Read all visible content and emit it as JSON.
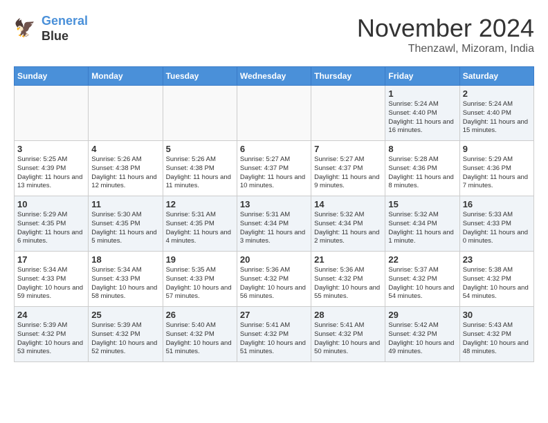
{
  "header": {
    "logo_line1": "General",
    "logo_line2": "Blue",
    "month": "November 2024",
    "location": "Thenzawl, Mizoram, India"
  },
  "weekdays": [
    "Sunday",
    "Monday",
    "Tuesday",
    "Wednesday",
    "Thursday",
    "Friday",
    "Saturday"
  ],
  "weeks": [
    [
      {
        "day": "",
        "text": ""
      },
      {
        "day": "",
        "text": ""
      },
      {
        "day": "",
        "text": ""
      },
      {
        "day": "",
        "text": ""
      },
      {
        "day": "",
        "text": ""
      },
      {
        "day": "1",
        "text": "Sunrise: 5:24 AM\nSunset: 4:40 PM\nDaylight: 11 hours and 16 minutes."
      },
      {
        "day": "2",
        "text": "Sunrise: 5:24 AM\nSunset: 4:40 PM\nDaylight: 11 hours and 15 minutes."
      }
    ],
    [
      {
        "day": "3",
        "text": "Sunrise: 5:25 AM\nSunset: 4:39 PM\nDaylight: 11 hours and 13 minutes."
      },
      {
        "day": "4",
        "text": "Sunrise: 5:26 AM\nSunset: 4:38 PM\nDaylight: 11 hours and 12 minutes."
      },
      {
        "day": "5",
        "text": "Sunrise: 5:26 AM\nSunset: 4:38 PM\nDaylight: 11 hours and 11 minutes."
      },
      {
        "day": "6",
        "text": "Sunrise: 5:27 AM\nSunset: 4:37 PM\nDaylight: 11 hours and 10 minutes."
      },
      {
        "day": "7",
        "text": "Sunrise: 5:27 AM\nSunset: 4:37 PM\nDaylight: 11 hours and 9 minutes."
      },
      {
        "day": "8",
        "text": "Sunrise: 5:28 AM\nSunset: 4:36 PM\nDaylight: 11 hours and 8 minutes."
      },
      {
        "day": "9",
        "text": "Sunrise: 5:29 AM\nSunset: 4:36 PM\nDaylight: 11 hours and 7 minutes."
      }
    ],
    [
      {
        "day": "10",
        "text": "Sunrise: 5:29 AM\nSunset: 4:35 PM\nDaylight: 11 hours and 6 minutes."
      },
      {
        "day": "11",
        "text": "Sunrise: 5:30 AM\nSunset: 4:35 PM\nDaylight: 11 hours and 5 minutes."
      },
      {
        "day": "12",
        "text": "Sunrise: 5:31 AM\nSunset: 4:35 PM\nDaylight: 11 hours and 4 minutes."
      },
      {
        "day": "13",
        "text": "Sunrise: 5:31 AM\nSunset: 4:34 PM\nDaylight: 11 hours and 3 minutes."
      },
      {
        "day": "14",
        "text": "Sunrise: 5:32 AM\nSunset: 4:34 PM\nDaylight: 11 hours and 2 minutes."
      },
      {
        "day": "15",
        "text": "Sunrise: 5:32 AM\nSunset: 4:34 PM\nDaylight: 11 hours and 1 minute."
      },
      {
        "day": "16",
        "text": "Sunrise: 5:33 AM\nSunset: 4:33 PM\nDaylight: 11 hours and 0 minutes."
      }
    ],
    [
      {
        "day": "17",
        "text": "Sunrise: 5:34 AM\nSunset: 4:33 PM\nDaylight: 10 hours and 59 minutes."
      },
      {
        "day": "18",
        "text": "Sunrise: 5:34 AM\nSunset: 4:33 PM\nDaylight: 10 hours and 58 minutes."
      },
      {
        "day": "19",
        "text": "Sunrise: 5:35 AM\nSunset: 4:33 PM\nDaylight: 10 hours and 57 minutes."
      },
      {
        "day": "20",
        "text": "Sunrise: 5:36 AM\nSunset: 4:32 PM\nDaylight: 10 hours and 56 minutes."
      },
      {
        "day": "21",
        "text": "Sunrise: 5:36 AM\nSunset: 4:32 PM\nDaylight: 10 hours and 55 minutes."
      },
      {
        "day": "22",
        "text": "Sunrise: 5:37 AM\nSunset: 4:32 PM\nDaylight: 10 hours and 54 minutes."
      },
      {
        "day": "23",
        "text": "Sunrise: 5:38 AM\nSunset: 4:32 PM\nDaylight: 10 hours and 54 minutes."
      }
    ],
    [
      {
        "day": "24",
        "text": "Sunrise: 5:39 AM\nSunset: 4:32 PM\nDaylight: 10 hours and 53 minutes."
      },
      {
        "day": "25",
        "text": "Sunrise: 5:39 AM\nSunset: 4:32 PM\nDaylight: 10 hours and 52 minutes."
      },
      {
        "day": "26",
        "text": "Sunrise: 5:40 AM\nSunset: 4:32 PM\nDaylight: 10 hours and 51 minutes."
      },
      {
        "day": "27",
        "text": "Sunrise: 5:41 AM\nSunset: 4:32 PM\nDaylight: 10 hours and 51 minutes."
      },
      {
        "day": "28",
        "text": "Sunrise: 5:41 AM\nSunset: 4:32 PM\nDaylight: 10 hours and 50 minutes."
      },
      {
        "day": "29",
        "text": "Sunrise: 5:42 AM\nSunset: 4:32 PM\nDaylight: 10 hours and 49 minutes."
      },
      {
        "day": "30",
        "text": "Sunrise: 5:43 AM\nSunset: 4:32 PM\nDaylight: 10 hours and 48 minutes."
      }
    ]
  ]
}
